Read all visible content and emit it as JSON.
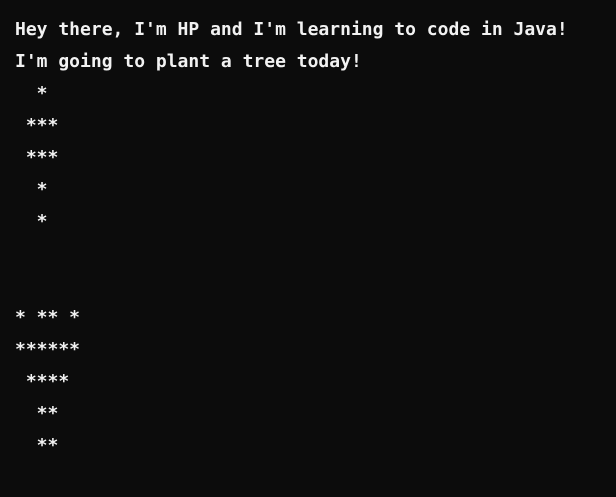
{
  "console": {
    "lines": [
      "Hey there, I'm HP and I'm learning to code in Java!",
      "I'm going to plant a tree today!",
      "  *",
      " ***",
      " ***",
      "  *",
      "  *",
      "",
      "",
      "* ** *",
      "******",
      " ****",
      "  **",
      "  **"
    ]
  }
}
